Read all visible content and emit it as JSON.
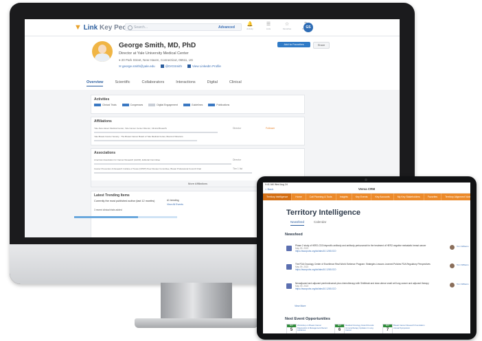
{
  "desktop": {
    "app": {
      "logo": {
        "mark": "▼",
        "word1": "Link",
        "word2": "Key People"
      },
      "search_placeholder": "Search...",
      "search_button": "Advanced",
      "nav_icons": [
        {
          "icon": "bell-icon",
          "label": "Activity"
        },
        {
          "icon": "list-icon",
          "label": "Lists"
        },
        {
          "icon": "star-icon",
          "label": "Favorites"
        },
        {
          "icon": "help-icon",
          "label": "Support"
        }
      ],
      "user_initials": "GS"
    },
    "profile": {
      "name": "George Smith, MD, PhD",
      "title": "Director at Yale University Medical Center",
      "address": "20 Park Street, New Haven, Connecticut, 06511, US",
      "email": "george.smith@yale.edu",
      "twitter": "@DrGSmith",
      "linkedin": "View LinkedIn Profile",
      "add_favorites": "Add to Favorites",
      "share": "Share"
    },
    "tabs": [
      "Overview",
      "Scientific",
      "Collaborators",
      "Interactions",
      "Digital",
      "Clinical"
    ],
    "activities": {
      "title": "Activities",
      "items": [
        "Clinical Trials",
        "Congresses",
        "Digital Engagement",
        "Guidelines",
        "Publications"
      ]
    },
    "affiliations": {
      "title": "Affiliations",
      "rows": [
        {
          "text": "Yale-New Haven Medical Center, Yale Cancer Center Director, Clinical Breast/S",
          "tag": "Director",
          "status": "Follower"
        },
        {
          "text": "Yale Breast Cancer Society - The Breast Cancer Board of Yale Medical Center, Board of Directors",
          "tag": "",
          "status": ""
        }
      ]
    },
    "associations": {
      "title": "Associations",
      "rows": [
        {
          "text": "American Association for Cancer Research (AACR), Editorial Committee",
          "tag": "Director"
        },
        {
          "text": "Cancer Prevention & Research Institute of Texas (CPRIT) Peer Review Committee, Breast Professional Council Chair",
          "tag": "Tier 1 list"
        }
      ],
      "more": "More Affiliations"
    },
    "latest_trending": {
      "title": "Latest Trending Items",
      "text": "Currently the most published author (last 12 months)",
      "badge": "#1 trending",
      "link": "View All Events",
      "row": "3 recent clinical trials added",
      "progress": 0.62
    }
  },
  "tablet": {
    "status_bar": "9:41 AM  Wed Aug 24",
    "back": "< Back",
    "app_title": "Veeva CRM",
    "orange_nav": [
      "Territory Intelligence",
      "Home",
      "Call Planning & Tools",
      "Insights",
      "Key Events",
      "Key Accounts",
      "My Key Stakeholders",
      "Favorites",
      "Territory Alignment Notes"
    ],
    "title": "Territory Intelligence",
    "tabs": [
      "Newsfeed",
      "Calendar"
    ],
    "newsfeed_title": "Newsfeed",
    "news": [
      {
        "text": "Phase 2 study of HER2-CD3 bispecific antibody and antibody-pertuzumab for the treatment of HER2-negative metastatic breast cancer",
        "date": "May 09, 2022",
        "link": "https://ascopubs.org/doi/abs/10.1200/JCO",
        "person": "Tom Williams"
      },
      {
        "text": "The FDA Oncology Center of Excellence Real World Evidence Program: Strategies Lessons Learned Policies FDA Regulatory Perspectives",
        "date": "May 09, 2022",
        "link": "https://ascopubs.org/doi/abs/10.1200/JCO",
        "person": "Tom Williams"
      },
      {
        "text": "Neoadjuvant and adjuvant pembrolizumab plus chemotherapy with Sintilimab and dose-dense small cell lung cancer and adjuvant therapy",
        "date": "May 09, 2022",
        "link": "https://ascopubs.org/doi/abs/10.1200/JCO",
        "person": "Tom Williams"
      }
    ],
    "view_all": "View More",
    "events_title": "Next Event Opportunities",
    "events": [
      {
        "month": "MAY",
        "day": "5",
        "text": "Workshop on Breast Cancer Diagnostics & Management Recent Advances"
      },
      {
        "month": "MAY",
        "day": "6",
        "text": "Medical Oncology Grand Rounds: Immunotherapy Updates in Lung Cancer"
      },
      {
        "month": "MAY",
        "day": "7",
        "text": "Breast Cancer Research Foundation Annual Symposium"
      }
    ]
  }
}
